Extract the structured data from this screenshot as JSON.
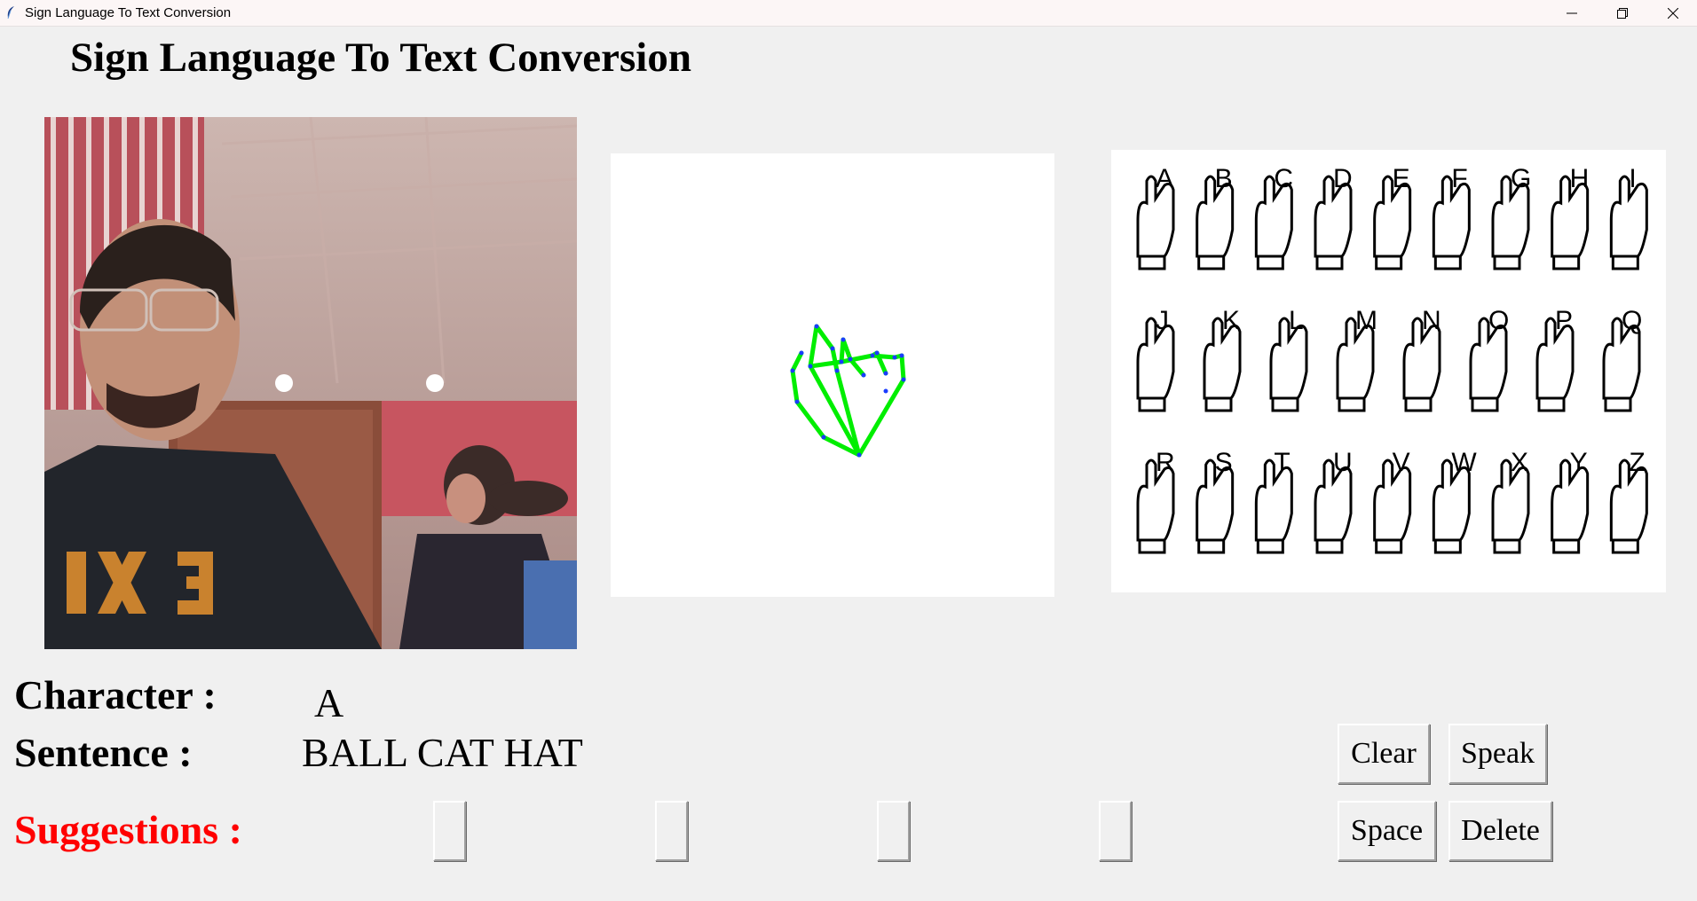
{
  "window": {
    "title": "Sign Language To Text Conversion",
    "controls": [
      "minimize",
      "restore",
      "close"
    ]
  },
  "header": {
    "title": "Sign Language To Text Conversion"
  },
  "panels": {
    "camera": {
      "description_icon": "camera-feed-image"
    },
    "skeleton": {
      "stroke_color": "#00ee00",
      "joint_color": "#1a3cff"
    },
    "chart": {
      "rows": [
        [
          "A",
          "B",
          "C",
          "D",
          "E",
          "F",
          "G",
          "H",
          "I"
        ],
        [
          "J",
          "K",
          "L",
          "M",
          "N",
          "O",
          "P",
          "Q"
        ],
        [
          "R",
          "S",
          "T",
          "U",
          "V",
          "W",
          "X",
          "Y",
          "Z"
        ]
      ]
    }
  },
  "output": {
    "character_label": "Character :",
    "character_value": "A",
    "sentence_label": "Sentence :",
    "sentence_value": "BALL CAT HAT",
    "suggestions_label": "Suggestions :",
    "suggestions_color": "#ff0000",
    "suggestions": [
      "",
      "",
      "",
      ""
    ]
  },
  "buttons": {
    "clear": "Clear",
    "speak": "Speak",
    "space": "Space",
    "delete": "Delete"
  }
}
